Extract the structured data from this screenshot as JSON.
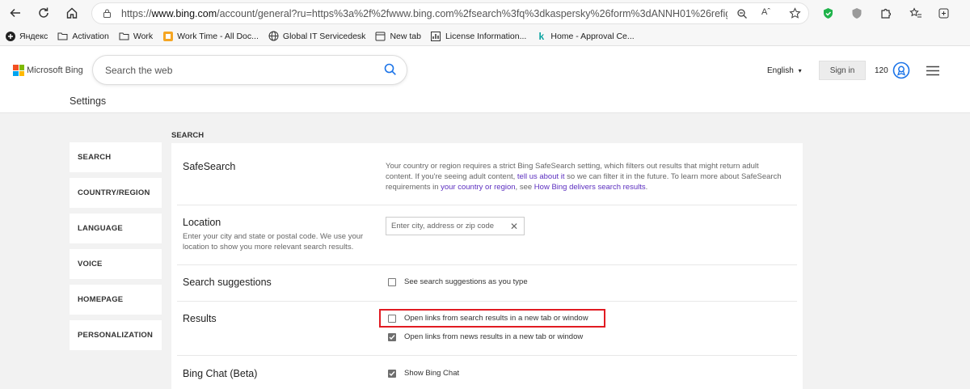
{
  "browser": {
    "url_prefix": "https://",
    "url_host": "www.bing.com",
    "url_rest": "/account/general?ru=https%3a%2f%2fwww.bing.com%2fsearch%3fq%3dkaspersky%26form%3dANNH01%26refig%3d680207e...",
    "bookmarks": [
      {
        "label": "Яндекс",
        "icon": "yandex-icon"
      },
      {
        "label": "Activation",
        "icon": "folder-icon"
      },
      {
        "label": "Work",
        "icon": "folder-icon"
      },
      {
        "label": "Work Time - All Doc...",
        "icon": "workpage-icon"
      },
      {
        "label": "Global IT Servicedesk",
        "icon": "globe-icon"
      },
      {
        "label": "New tab",
        "icon": "newtab-icon"
      },
      {
        "label": "License Information...",
        "icon": "chart-icon"
      },
      {
        "label": "Home - Approval Ce...",
        "icon": "k-icon"
      }
    ]
  },
  "header": {
    "logo_text": "Microsoft Bing",
    "search_placeholder": "Search the web",
    "language": "English",
    "signin_label": "Sign in",
    "points": "120",
    "page_title": "Settings"
  },
  "sidebar": {
    "items": [
      {
        "label": "SEARCH"
      },
      {
        "label": "COUNTRY/REGION"
      },
      {
        "label": "LANGUAGE"
      },
      {
        "label": "VOICE"
      },
      {
        "label": "HOMEPAGE"
      },
      {
        "label": "PERSONALIZATION"
      }
    ]
  },
  "main": {
    "section_label": "SEARCH",
    "safesearch": {
      "title": "SafeSearch",
      "desc_1": "Your country or region requires a strict Bing SafeSearch setting, which filters out results that might return adult content. If you're seeing adult content, ",
      "link_1": "tell us about it",
      "desc_2": " so we can filter it in the future. To learn more about SafeSearch requirements in ",
      "link_2": "your country or region",
      "desc_3": ", see ",
      "link_3": "How Bing delivers search results",
      "desc_4": "."
    },
    "location": {
      "title": "Location",
      "subtitle": "Enter your city and state or postal code. We use your location to show you more relevant search results.",
      "placeholder": "Enter city, address or zip code"
    },
    "suggestions": {
      "title": "Search suggestions",
      "option": "See search suggestions as you type",
      "checked": false
    },
    "results": {
      "title": "Results",
      "option_1": "Open links from search results in a new tab or window",
      "option_1_checked": false,
      "option_2": "Open links from news results in a new tab or window",
      "option_2_checked": true
    },
    "bingchat": {
      "title": "Bing Chat (Beta)",
      "option": "Show Bing Chat",
      "checked": true
    }
  },
  "colors": {
    "highlight": "#e11b22",
    "link": "#5b2ebf",
    "accent": "#1a73e8"
  }
}
